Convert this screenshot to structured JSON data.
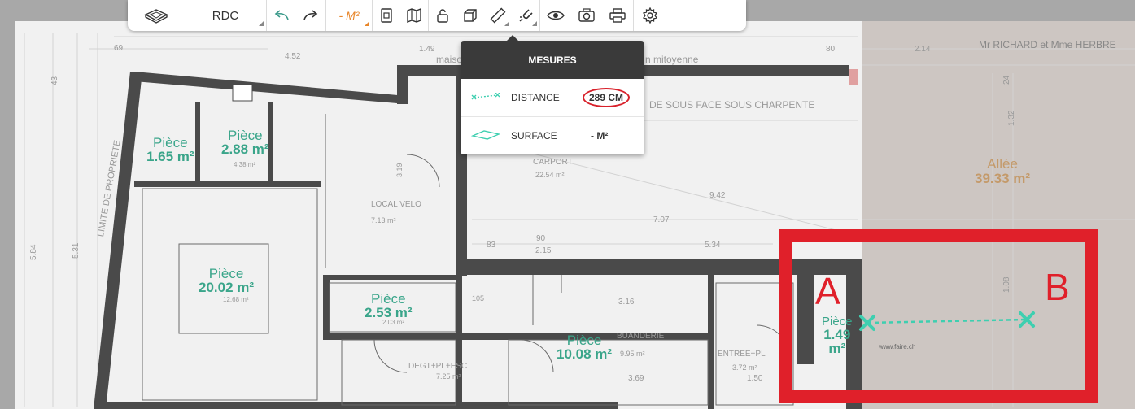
{
  "toolbar": {
    "level": "RDC",
    "area": "- M²"
  },
  "measures_panel": {
    "title": "MESURES",
    "distance_label": "DISTANCE",
    "distance_value": "289 CM",
    "surface_label": "SURFACE",
    "surface_value": "- M²"
  },
  "rooms": [
    {
      "name": "Pièce",
      "area": "1.65 m²"
    },
    {
      "name": "Pièce",
      "area": "2.88 m²"
    },
    {
      "name": "Pièce",
      "area": "20.02 m²"
    },
    {
      "name": "Pièce",
      "area": "2.53 m²"
    },
    {
      "name": "Pièce",
      "area": "10.08 m²"
    },
    {
      "name": "Pièce",
      "area": "1.49",
      "unit": "m²"
    },
    {
      "name": "Allée",
      "area": "39.33 m²"
    }
  ],
  "plan_text": {
    "owner": "Mr RICHARD et Mme HERBRE",
    "limite": "LIMITE DE PROPRIETE",
    "local_velo": "LOCAL VELO",
    "local_velo_area": "7.13 m²",
    "carport": "CARPORT",
    "carport_area": "22.54 m²",
    "buanderie": "BUANDERIE",
    "buanderie_area": "9.95 m²",
    "degt": "DEGT+PL+ESC",
    "degt_area": "7.25 m²",
    "entree": "ENTREE+PL",
    "entree_area": "3.72 m²",
    "maison": "maiso",
    "mitoyenne": "n mitoyenne",
    "sous_face": "DE SOUS FACE SOUS CHARPENTE",
    "dim_452": "4.52",
    "dim_149": "1.49",
    "dim_69": "69",
    "dim_80": "80",
    "dim_214": "2.14",
    "dim_707": "7.07",
    "dim_942": "9.42",
    "dim_534": "5.34",
    "dim_83": "83",
    "dim_90": "90",
    "dim_215": "2.15",
    "dim_584": "5.84",
    "dim_531": "5.31",
    "dim_43": "43",
    "dim_132": "1.32",
    "dim_24": "24",
    "dim_108": "1.08",
    "dim_316": "3.16",
    "dim_369": "3.69",
    "dim_150": "1.50",
    "dim_438": "4.38 m²",
    "dim_1268": "12.68 m²",
    "dim_203": "2.03 m²",
    "dim_105": "105",
    "dim_319": "3.19",
    "site": "www.faire.ch"
  },
  "annotations": {
    "point_a": "A",
    "point_b": "B"
  },
  "colors": {
    "accent_orange": "#e8862a",
    "measure_teal": "#3ecfb0",
    "highlight_red": "#e0202a",
    "panel_dark": "#3a3a3a"
  }
}
